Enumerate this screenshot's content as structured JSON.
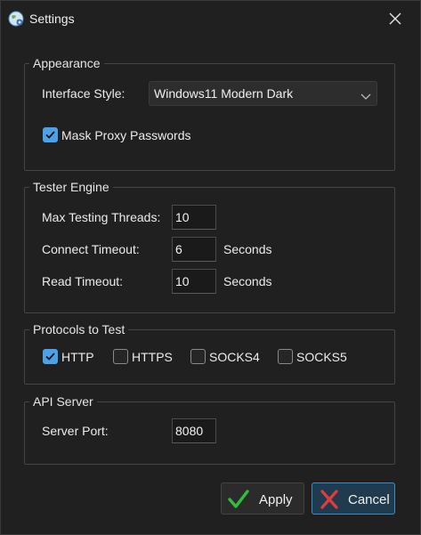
{
  "window": {
    "title": "Settings",
    "icon": "globe-app-icon"
  },
  "appearance": {
    "legend": "Appearance",
    "interface_style_label": "Interface Style:",
    "interface_style_value": "Windows11 Modern Dark",
    "mask_passwords_label": "Mask Proxy Passwords",
    "mask_passwords_checked": true
  },
  "tester": {
    "legend": "Tester Engine",
    "max_threads_label": "Max Testing Threads:",
    "max_threads_value": "10",
    "connect_timeout_label": "Connect Timeout:",
    "connect_timeout_value": "6",
    "connect_timeout_unit": "Seconds",
    "read_timeout_label": "Read Timeout:",
    "read_timeout_value": "10",
    "read_timeout_unit": "Seconds"
  },
  "protocols": {
    "legend": "Protocols to Test",
    "items": [
      {
        "label": "HTTP",
        "checked": true
      },
      {
        "label": "HTTPS",
        "checked": false
      },
      {
        "label": "SOCKS4",
        "checked": false
      },
      {
        "label": "SOCKS5",
        "checked": false
      }
    ]
  },
  "api": {
    "legend": "API Server",
    "port_label": "Server Port:",
    "port_value": "8080"
  },
  "buttons": {
    "apply_label": "Apply",
    "cancel_label": "Cancel"
  },
  "colors": {
    "accent": "#4aa3ea",
    "apply_check": "#2fbf3a",
    "cancel_x": "#e23b3b"
  }
}
